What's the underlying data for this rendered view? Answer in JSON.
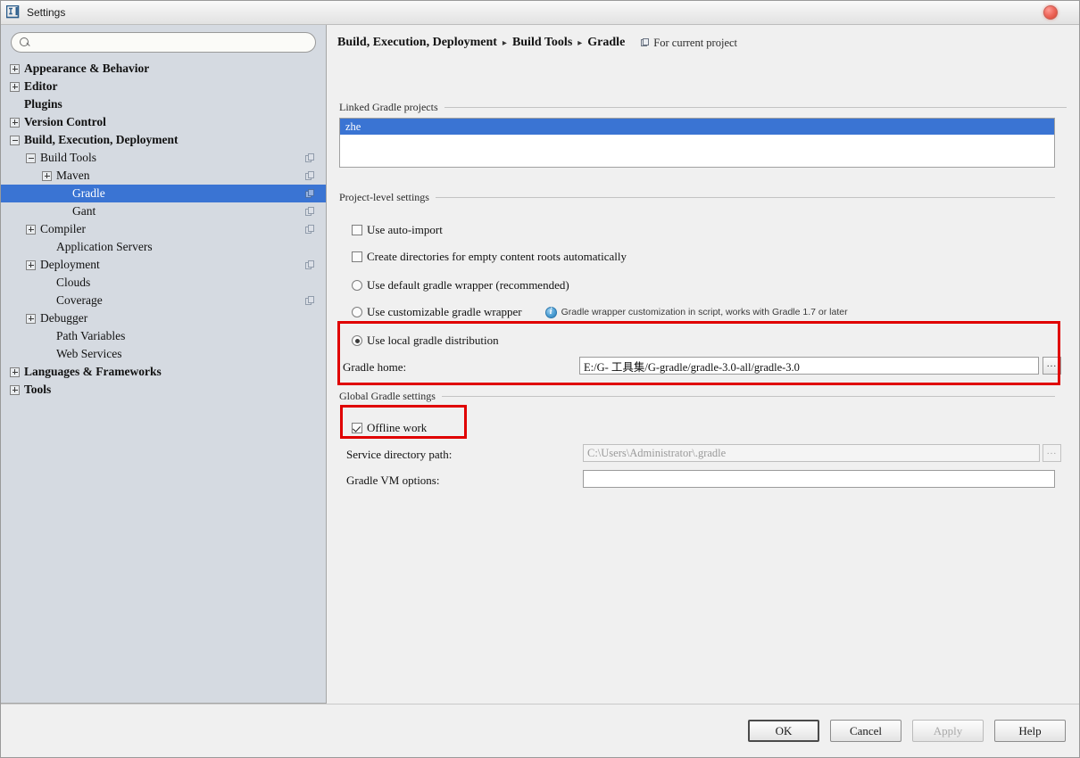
{
  "window": {
    "title": "Settings",
    "app_icon": "intellij-idea-icon",
    "close_label": "close-icon"
  },
  "sidebar": {
    "search": {
      "value": "",
      "placeholder": "",
      "icon": "search-icon"
    },
    "items": [
      {
        "label": "Appearance & Behavior",
        "indent": 0,
        "toggle": "plus",
        "bold": true,
        "selected": false,
        "module_icon": false
      },
      {
        "label": "Editor",
        "indent": 0,
        "toggle": "plus",
        "bold": true,
        "selected": false,
        "module_icon": false
      },
      {
        "label": "Plugins",
        "indent": 0,
        "toggle": "none",
        "bold": true,
        "selected": false,
        "module_icon": false
      },
      {
        "label": "Version Control",
        "indent": 0,
        "toggle": "plus",
        "bold": true,
        "selected": false,
        "module_icon": false
      },
      {
        "label": "Build, Execution, Deployment",
        "indent": 0,
        "toggle": "minus",
        "bold": true,
        "selected": false,
        "module_icon": false
      },
      {
        "label": "Build Tools",
        "indent": 1,
        "toggle": "minus",
        "bold": false,
        "selected": false,
        "module_icon": true
      },
      {
        "label": "Maven",
        "indent": 2,
        "toggle": "plus",
        "bold": false,
        "selected": false,
        "module_icon": true
      },
      {
        "label": "Gradle",
        "indent": 3,
        "toggle": "none",
        "bold": false,
        "selected": true,
        "module_icon": true
      },
      {
        "label": "Gant",
        "indent": 3,
        "toggle": "none",
        "bold": false,
        "selected": false,
        "module_icon": true
      },
      {
        "label": "Compiler",
        "indent": 1,
        "toggle": "plus",
        "bold": false,
        "selected": false,
        "module_icon": true
      },
      {
        "label": "Application Servers",
        "indent": 2,
        "toggle": "none",
        "bold": false,
        "selected": false,
        "module_icon": false
      },
      {
        "label": "Deployment",
        "indent": 1,
        "toggle": "plus",
        "bold": false,
        "selected": false,
        "module_icon": true
      },
      {
        "label": "Clouds",
        "indent": 2,
        "toggle": "none",
        "bold": false,
        "selected": false,
        "module_icon": false
      },
      {
        "label": "Coverage",
        "indent": 2,
        "toggle": "none",
        "bold": false,
        "selected": false,
        "module_icon": true
      },
      {
        "label": "Debugger",
        "indent": 1,
        "toggle": "plus",
        "bold": false,
        "selected": false,
        "module_icon": false
      },
      {
        "label": "Path Variables",
        "indent": 2,
        "toggle": "none",
        "bold": false,
        "selected": false,
        "module_icon": false
      },
      {
        "label": "Web Services",
        "indent": 2,
        "toggle": "none",
        "bold": false,
        "selected": false,
        "module_icon": false
      },
      {
        "label": "Languages & Frameworks",
        "indent": 0,
        "toggle": "plus",
        "bold": true,
        "selected": false,
        "module_icon": false
      },
      {
        "label": "Tools",
        "indent": 0,
        "toggle": "plus",
        "bold": true,
        "selected": false,
        "module_icon": false
      }
    ]
  },
  "main": {
    "breadcrumb": {
      "parts": [
        "Build, Execution, Deployment",
        "Build Tools",
        "Gradle"
      ],
      "separator": "▸",
      "scope_label": "For current project",
      "scope_icon": "project-scope-icon"
    },
    "groups": {
      "linked_projects": "Linked Gradle projects",
      "project_level": "Project-level settings",
      "global_settings": "Global Gradle settings"
    },
    "linked_projects": {
      "items": [
        {
          "label": "zhe",
          "selected": true
        }
      ]
    },
    "options": {
      "use_auto_import": {
        "label": "Use auto-import",
        "checked": false
      },
      "create_directories": {
        "label": "Create directories for empty content roots automatically",
        "checked": false
      },
      "use_default_wrapper": {
        "label": "Use default gradle wrapper (recommended)",
        "selected": false
      },
      "use_customizable_wrapper": {
        "label": "Use customizable gradle wrapper",
        "selected": false,
        "hint": "Gradle wrapper customization in script, works with Gradle 1.7 or later",
        "hint_icon": "info-icon"
      },
      "use_local_distribution": {
        "label": "Use local gradle distribution",
        "selected": true
      }
    },
    "fields": {
      "gradle_home": {
        "label": "Gradle home:",
        "value": "E:/G- 工具集/G-gradle/gradle-3.0-all/gradle-3.0",
        "browse": "...",
        "disabled": false
      },
      "service_directory": {
        "label": "Service directory path:",
        "value": "C:\\Users\\Administrator\\.gradle",
        "browse": "...",
        "disabled": true
      },
      "gradle_vm_options": {
        "label": "Gradle VM options:",
        "value": "",
        "disabled": false
      }
    },
    "global": {
      "offline_work": {
        "label": "Offline work",
        "checked": true
      }
    },
    "annotations": {
      "highlight_color": "#e00000",
      "boxes": [
        "local-distribution-highlight",
        "offline-work-highlight"
      ]
    }
  },
  "footer": {
    "ok": "OK",
    "cancel": "Cancel",
    "apply": "Apply",
    "help": "Help",
    "apply_disabled": true
  }
}
